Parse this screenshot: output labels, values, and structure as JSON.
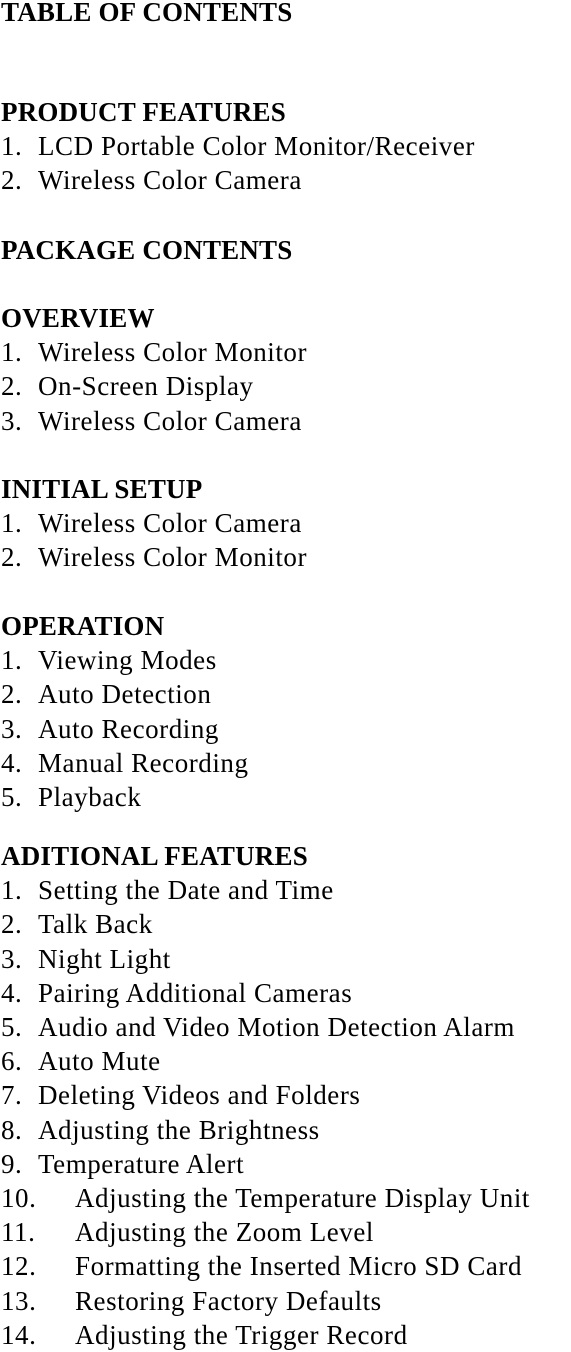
{
  "document": {
    "title": "TABLE OF CONTENTS",
    "sections": [
      {
        "heading": "PRODUCT FEATURES",
        "items": [
          {
            "number": "1.",
            "label": "LCD Portable Color Monitor/Receiver"
          },
          {
            "number": "2.",
            "label": "Wireless Color Camera"
          }
        ]
      },
      {
        "heading": "PACKAGE CONTENTS",
        "items": []
      },
      {
        "heading": "OVERVIEW",
        "items": [
          {
            "number": "1.",
            "label": "Wireless Color Monitor"
          },
          {
            "number": "2.",
            "label": "On-Screen Display"
          },
          {
            "number": "3.",
            "label": "Wireless Color Camera"
          }
        ]
      },
      {
        "heading": "INITIAL SETUP",
        "items": [
          {
            "number": "1.",
            "label": "Wireless Color Camera"
          },
          {
            "number": "2.",
            "label": "Wireless Color Monitor"
          }
        ]
      },
      {
        "heading": "OPERATION",
        "items": [
          {
            "number": "1.",
            "label": "Viewing Modes"
          },
          {
            "number": "2.",
            "label": "Auto Detection"
          },
          {
            "number": "3.",
            "label": "Auto Recording"
          },
          {
            "number": "4.",
            "label": "Manual Recording"
          },
          {
            "number": "5.",
            "label": "Playback"
          }
        ]
      },
      {
        "heading": "ADITIONAL FEATURES",
        "items": [
          {
            "number": "1.",
            "label": "Setting the Date and Time"
          },
          {
            "number": "2.",
            "label": "Talk Back"
          },
          {
            "number": "3.",
            "label": "Night Light"
          },
          {
            "number": "4.",
            "label": "Pairing Additional Cameras"
          },
          {
            "number": "5.",
            "label": "Audio and Video Motion Detection Alarm"
          },
          {
            "number": "6.",
            "label": "Auto Mute"
          },
          {
            "number": "7.",
            "label": "Deleting Videos and Folders"
          },
          {
            "number": "8.",
            "label": "Adjusting the Brightness"
          },
          {
            "number": "9.",
            "label": "Temperature Alert"
          },
          {
            "number": "10.",
            "label": "Adjusting the Temperature Display Unit"
          },
          {
            "number": "11.",
            "label": "Adjusting the Zoom Level"
          },
          {
            "number": "12.",
            "label": "Formatting the Inserted Micro SD Card"
          },
          {
            "number": "13.",
            "label": "Restoring Factory Defaults"
          },
          {
            "number": "14.",
            "label": "Adjusting the Trigger Record"
          }
        ]
      }
    ]
  }
}
